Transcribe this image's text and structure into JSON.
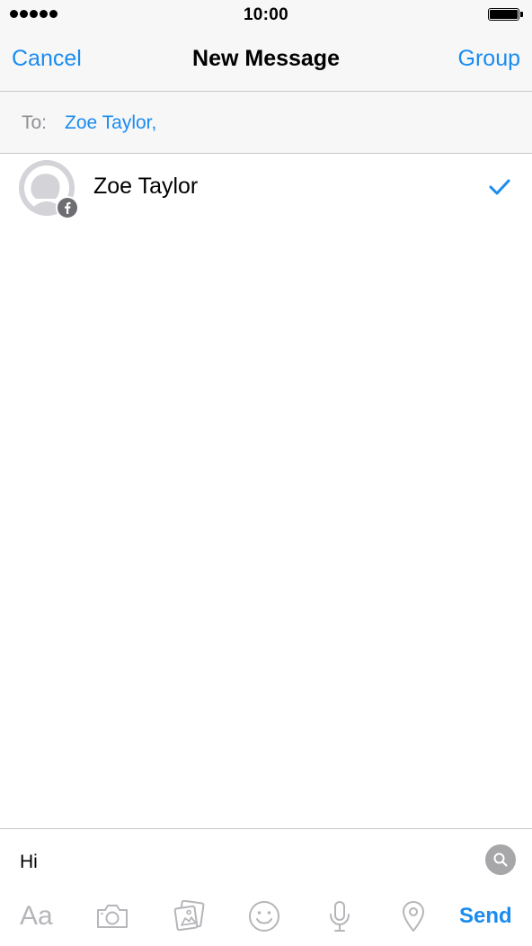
{
  "status_bar": {
    "time": "10:00",
    "signal_icon": "signal-dots-icon",
    "battery_icon": "battery-full-icon"
  },
  "nav": {
    "left_label": "Cancel",
    "title": "New Message",
    "right_label": "Group"
  },
  "to": {
    "label": "To:",
    "recipients": "Zoe Taylor,"
  },
  "contacts": [
    {
      "name": "Zoe Taylor",
      "avatar_icon": "default-avatar-icon",
      "badge_icon": "facebook-badge-icon",
      "selected": true
    }
  ],
  "composer": {
    "text": "Hi",
    "search_icon": "search-icon"
  },
  "toolbar": {
    "text_format_label": "Aa",
    "icons": [
      "camera-icon",
      "gallery-icon",
      "emoji-icon",
      "microphone-icon",
      "location-icon"
    ],
    "send_label": "Send"
  },
  "colors": {
    "accent": "#1a8cf0",
    "bar_background": "#f7f7f7",
    "separator": "#c8c7cc",
    "icon_gray": "#b6b6ba"
  }
}
